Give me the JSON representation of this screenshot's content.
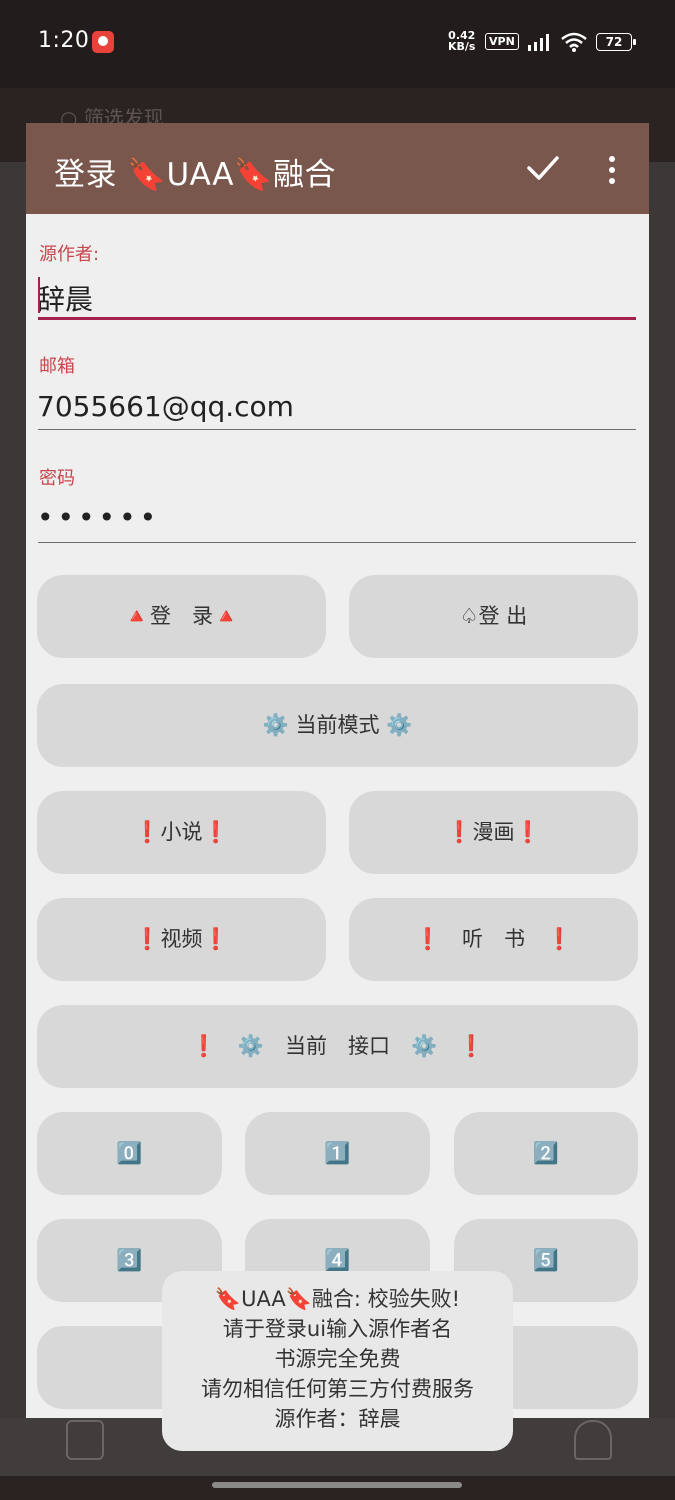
{
  "status_bar": {
    "time": "1:20",
    "net_speed_value": "0.42",
    "net_speed_unit": "KB/s",
    "vpn": "VPN",
    "battery": "72"
  },
  "background": {
    "search_placeholder": "筛选发现"
  },
  "dialog": {
    "title": "登录 🔖UAA🔖融合",
    "confirm_icon": "check-icon",
    "menu_icon": "more-vert-icon",
    "fields": [
      {
        "label": "源作者:",
        "value": "辞晨"
      },
      {
        "label": "邮箱",
        "value": "7055661@qq.com"
      },
      {
        "label": "密码",
        "value": "••••••"
      }
    ],
    "buttons": {
      "login": "🔺登　录🔺",
      "logout": "♤登 出",
      "current_mode": "⚙️ 当前模式 ⚙️",
      "novel": "❗小说❗",
      "comic": "❗漫画❗",
      "video": "❗视频❗",
      "audiobook": "❗　听　书　❗",
      "current_api": "❗　⚙️　当前　接口　⚙️　❗",
      "num0": "0️⃣",
      "num1": "1️⃣",
      "num2": "2️⃣",
      "num3": "3️⃣",
      "num4": "4️⃣",
      "num5": "5️⃣"
    }
  },
  "toast": {
    "lines": [
      "🔖UAA🔖融合: 校验失败!",
      "请于登录ui输入源作者名",
      "书源完全免费",
      "请勿相信任何第三方付费服务",
      "源作者：辞晨"
    ]
  },
  "colors": {
    "toolbar": "#79574d",
    "accent": "#a3204f",
    "label": "#c7474d",
    "button": "#d8d8d8"
  }
}
